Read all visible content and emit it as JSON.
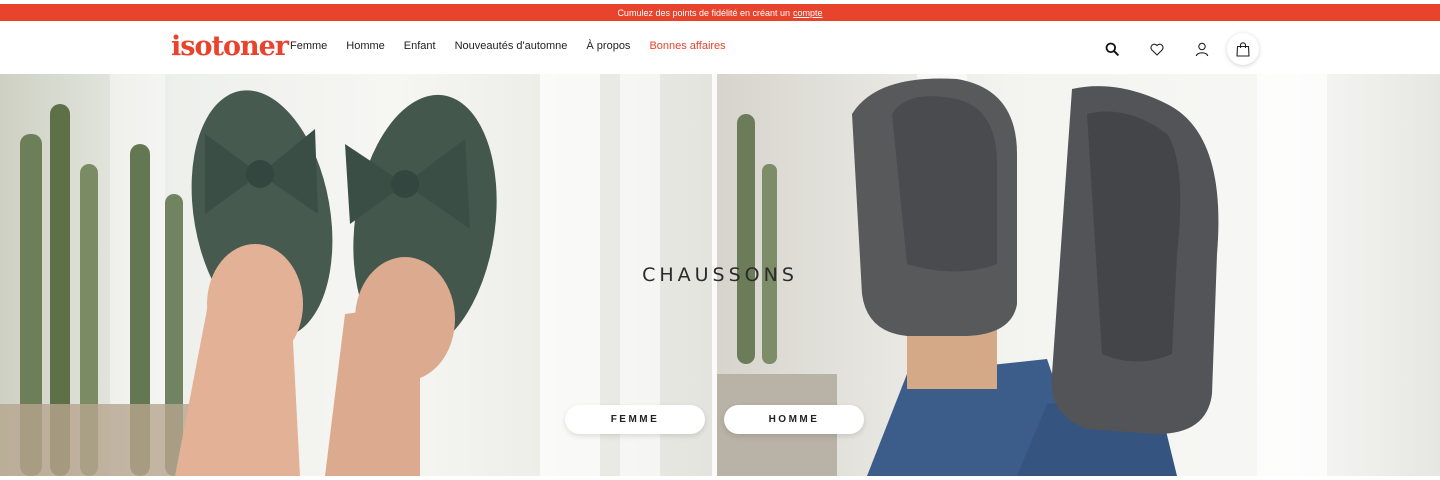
{
  "promo": {
    "text": "Cumulez des points de fidélité en créant un",
    "link": "compte"
  },
  "header": {
    "logo": "isotoner",
    "nav": [
      {
        "label": "Femme"
      },
      {
        "label": "Homme"
      },
      {
        "label": "Enfant"
      },
      {
        "label": "Nouveautés d'automne"
      },
      {
        "label": "À propos"
      },
      {
        "label": "Bonnes affaires"
      }
    ],
    "icons": [
      "search-icon",
      "heart-icon",
      "user-icon",
      "shopping-bag-icon"
    ]
  },
  "hero": {
    "title": "CHAUSSONS",
    "buttons": {
      "femme": "FEMME",
      "homme": "HOMME"
    },
    "images": {
      "left": "green velvet bow ballerina slippers",
      "right": "grey suede moccasin slippers"
    }
  },
  "colors": {
    "brand": "#e8432d",
    "text": "#222222",
    "background": "#ffffff"
  }
}
